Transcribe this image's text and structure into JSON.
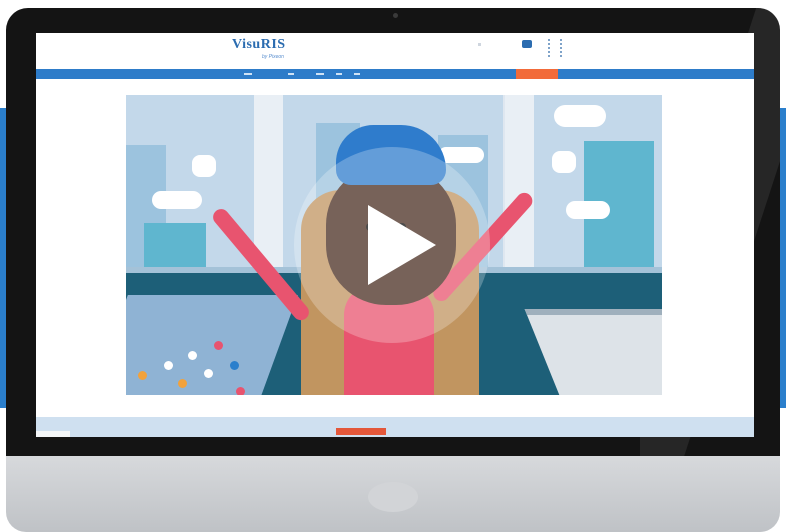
{
  "site": {
    "logo_text": "VisuRIS",
    "logo_subtext": "by Pixeon"
  },
  "nav": {
    "cta_color": "#f26b3a",
    "bar_color": "#2e7cc9"
  },
  "video": {
    "play_control": "play-icon",
    "state": "paused"
  },
  "colors": {
    "accent_blue": "#2b7fcc",
    "monitor_bezel": "#141414"
  }
}
